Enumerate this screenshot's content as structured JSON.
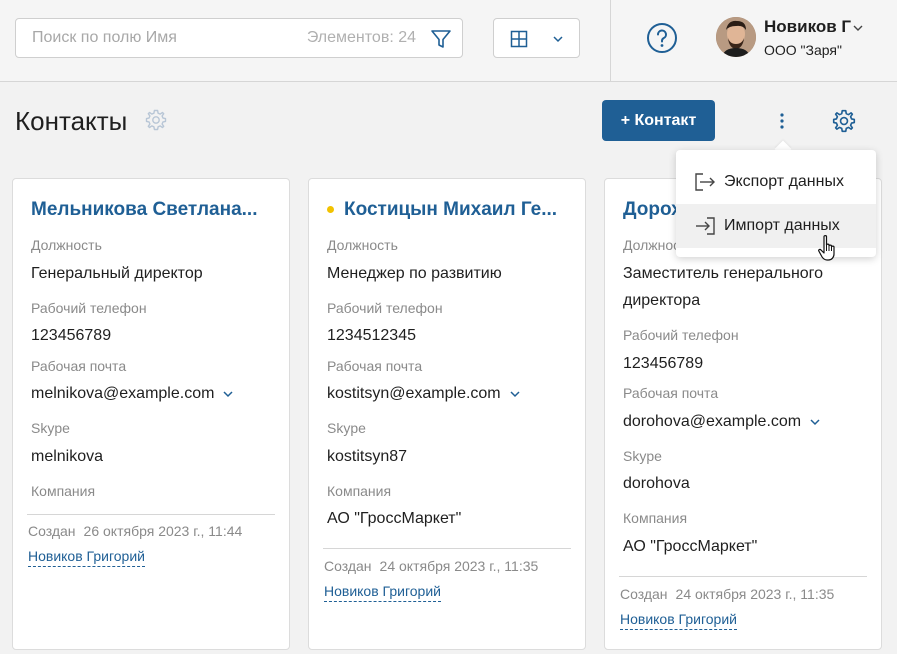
{
  "topbar": {
    "search_placeholder": "Поиск по полю Имя",
    "items_count": "Элементов: 24",
    "user": {
      "name": "Новиков Г",
      "org": "ООО \"Заря\""
    }
  },
  "page": {
    "title": "Контакты",
    "add_button": "+ Контакт"
  },
  "menu": {
    "items": [
      {
        "label": "Экспорт данных",
        "icon": "export-icon"
      },
      {
        "label": "Импорт данных",
        "icon": "import-icon"
      }
    ]
  },
  "labels": {
    "position": "Должность",
    "phone": "Рабочий телефон",
    "email": "Рабочая почта",
    "skype": "Skype",
    "company": "Компания",
    "created": "Создан"
  },
  "cards": [
    {
      "name": "Мельникова Светлана...",
      "position": "Генеральный директор",
      "phone": "123456789",
      "email": "melnikova@example.com",
      "skype": "melnikova",
      "company": "",
      "created_at": "26 октября 2023 г., 11:44",
      "author": "Новиков Григорий"
    },
    {
      "name": "Костицын Михаил Ге...",
      "position": "Менеджер по развитию",
      "phone": "1234512345",
      "email": "kostitsyn@example.com",
      "skype": "kostitsyn87",
      "company": "АО \"ГроссМаркет\"",
      "created_at": "24 октября 2023 г., 11:35",
      "author": "Новиков Григорий"
    },
    {
      "name": "Дорохова",
      "position": "Заместитель генерального директора",
      "phone": "123456789",
      "email": "dorohova@example.com",
      "skype": "dorohova",
      "company": "АО \"ГроссМаркет\"",
      "created_at": "24 октября 2023 г., 11:35",
      "author": "Новиков Григорий"
    }
  ],
  "colors": {
    "accent": "#1f5f95",
    "status_dot": "#f2c200"
  }
}
